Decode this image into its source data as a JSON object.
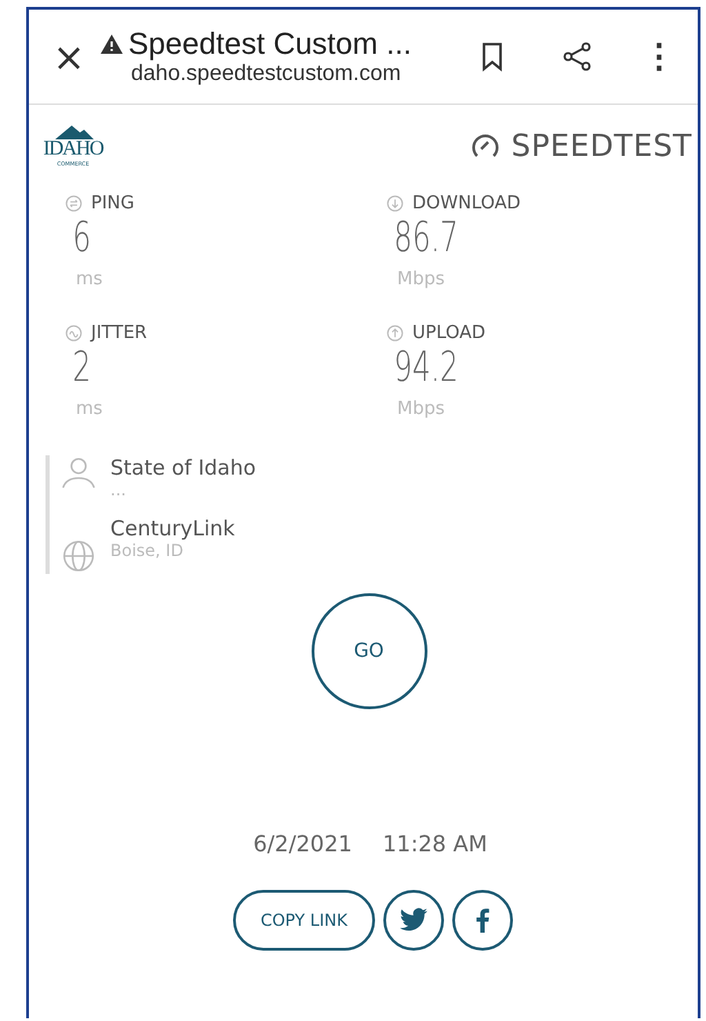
{
  "browser_bar": {
    "close": "×",
    "title": "Speedtest Custom ...",
    "url": "daho.speedtestcustom.com",
    "menu": "⋮"
  },
  "header": {
    "logo_text": "IDAHO",
    "logo_subtext": "COMMERCE",
    "brand": "SPEEDTEST"
  },
  "metrics": [
    {
      "kind": "ping",
      "label": "PING",
      "value": "6",
      "unit": "ms"
    },
    {
      "kind": "download",
      "label": "DOWNLOAD",
      "value": "86.7",
      "unit": "Mbps"
    },
    {
      "kind": "jitter",
      "label": "JITTER",
      "value": "2",
      "unit": "ms"
    },
    {
      "kind": "upload",
      "label": "UPLOAD",
      "value": "94.2",
      "unit": "Mbps"
    }
  ],
  "connection": [
    {
      "kind": "client",
      "name": "State of Idaho",
      "detail": "..."
    },
    {
      "kind": "server",
      "name": "CenturyLink",
      "detail": "Boise, ID"
    }
  ],
  "go_button": "GO",
  "result": {
    "date": "6/2/2021",
    "time": "11:28 AM"
  },
  "share": {
    "copy_link": "COPY LINK"
  }
}
